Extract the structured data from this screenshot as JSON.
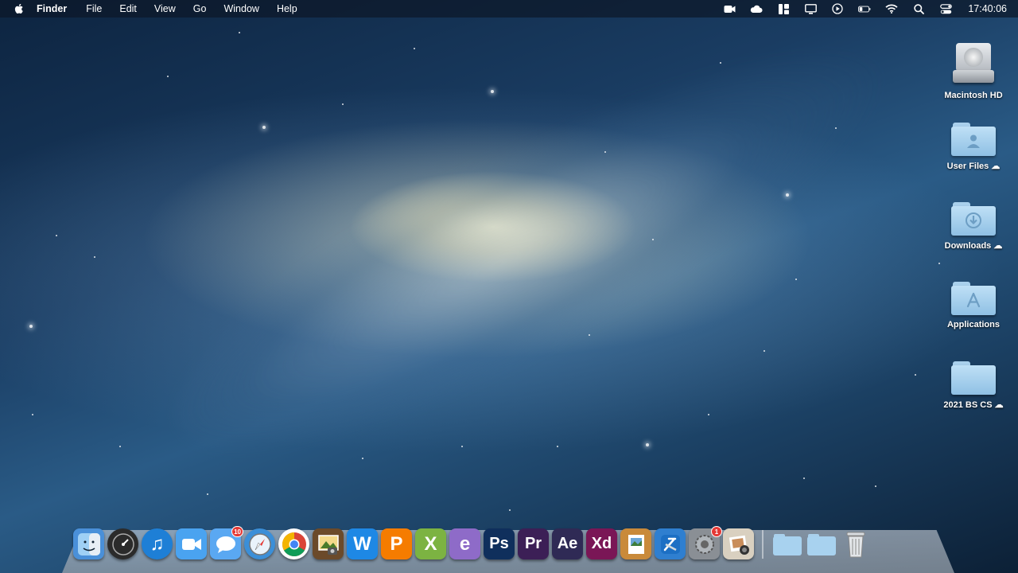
{
  "menubar": {
    "app_name": "Finder",
    "items": [
      "File",
      "Edit",
      "View",
      "Go",
      "Window",
      "Help"
    ],
    "status_icons": [
      "facetime-icon",
      "icloud-icon",
      "layout-icon",
      "display-icon",
      "play-icon",
      "battery-icon",
      "wifi-icon",
      "search-icon",
      "control-center-icon"
    ],
    "clock": "17:40:06"
  },
  "desktop": {
    "items": [
      {
        "label": "Macintosh HD",
        "icon": "hard-drive-icon",
        "cloud": false
      },
      {
        "label": "User Files",
        "icon": "user-folder-icon",
        "cloud": true
      },
      {
        "label": "Downloads",
        "icon": "downloads-folder-icon",
        "cloud": true
      },
      {
        "label": "Applications",
        "icon": "applications-folder-icon",
        "cloud": false
      },
      {
        "label": "2021 BS CS",
        "icon": "folder-icon",
        "cloud": true
      }
    ],
    "cloud_glyph": "☁"
  },
  "dock": {
    "apps": [
      {
        "name": "finder-icon",
        "text": "",
        "color": "#4a90d9"
      },
      {
        "name": "dashboard-icon",
        "text": "",
        "color": "#2b2b2b"
      },
      {
        "name": "itunes-icon",
        "text": "♫",
        "color": "#1e7fd6"
      },
      {
        "name": "facetime-icon",
        "text": "",
        "color": "#4aa3f0"
      },
      {
        "name": "messages-icon",
        "text": "",
        "color": "#5aa8f2",
        "badge": "10"
      },
      {
        "name": "safari-icon",
        "text": "",
        "color": "#3b8fd8"
      },
      {
        "name": "chrome-icon",
        "text": "",
        "color": "#ffffff"
      },
      {
        "name": "iphoto-icon",
        "text": "",
        "color": "#6b4a2a"
      },
      {
        "name": "word-icon",
        "text": "W",
        "color": "#1e88e5"
      },
      {
        "name": "powerpoint-icon",
        "text": "P",
        "color": "#f57c00"
      },
      {
        "name": "excel-icon",
        "text": "X",
        "color": "#7cb342"
      },
      {
        "name": "entourage-icon",
        "text": "e",
        "color": "#8e6bc8"
      },
      {
        "name": "photoshop-icon",
        "text": "Ps",
        "color": "#0f2f5c"
      },
      {
        "name": "premiere-icon",
        "text": "Pr",
        "color": "#3c1f56"
      },
      {
        "name": "after-effects-icon",
        "text": "Ae",
        "color": "#2f2a55"
      },
      {
        "name": "xd-icon",
        "text": "Xd",
        "color": "#7a1656"
      },
      {
        "name": "preview-icon",
        "text": "",
        "color": "#c98a3a"
      },
      {
        "name": "xcode-icon",
        "text": "",
        "color": "#2f7fd0"
      },
      {
        "name": "system-preferences-icon",
        "text": "",
        "color": "#8a8f95",
        "badge": "1"
      },
      {
        "name": "photo-browser-icon",
        "text": "",
        "color": "#d9d0c0"
      }
    ],
    "stacks": [
      {
        "name": "applications-stack-icon"
      },
      {
        "name": "downloads-stack-icon"
      },
      {
        "name": "trash-icon"
      }
    ]
  }
}
